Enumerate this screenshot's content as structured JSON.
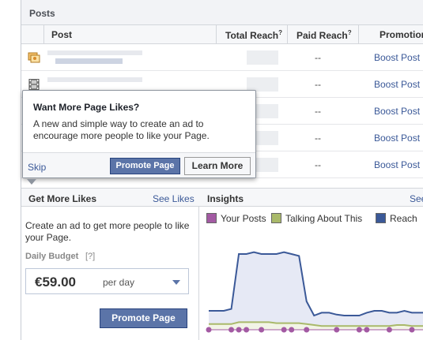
{
  "posts": {
    "title": "Posts",
    "columns": {
      "post": "Post",
      "total_reach": "Total Reach",
      "total_reach_help": "?",
      "paid_reach": "Paid Reach",
      "paid_reach_help": "?",
      "promotion": "Promotion"
    },
    "rows": [
      {
        "icon": "photo-icon",
        "paid_reach": "--",
        "action": "Boost Post"
      },
      {
        "icon": "video-icon",
        "paid_reach": "--",
        "action": "Boost Post"
      },
      {
        "icon": "post-icon",
        "paid_reach": "--",
        "action": "Boost Post"
      },
      {
        "icon": "post-icon",
        "paid_reach": "--",
        "action": "Boost Post"
      },
      {
        "icon": "post-icon",
        "paid_reach": "--",
        "action": "Boost Post"
      }
    ]
  },
  "popover": {
    "title": "Want More Page Likes?",
    "text": "A new and simple way to get create an ad to encourage more people to like your Page.",
    "skip": "Skip",
    "promote": "Promote Page",
    "learn_more": "Learn More"
  },
  "likes": {
    "title": "Get More Likes",
    "see_likes": "See Likes",
    "text": "Create an ad to get more people to like your Page.",
    "budget_label": "Daily Budget",
    "budget_help": "[?]",
    "budget_amount": "€59.00",
    "budget_unit": "per day",
    "promote": "Promote Page"
  },
  "insights": {
    "title": "Insights",
    "see_all": "See",
    "legend": [
      {
        "name": "Your Posts",
        "color": "#a35aa3"
      },
      {
        "name": "Talking About This",
        "color": "#a9b96a"
      },
      {
        "name": "Reach",
        "color": "#3b5998"
      }
    ]
  },
  "chart_data": {
    "type": "area",
    "series": [
      {
        "name": "Reach",
        "color": "#3b5998",
        "fill": "#e6e9f5",
        "values": [
          20,
          20,
          20,
          22,
          80,
          80,
          82,
          80,
          80,
          80,
          82,
          80,
          78,
          30,
          15,
          18,
          18,
          16,
          15,
          15,
          15,
          18,
          20,
          20,
          18,
          18,
          20,
          18,
          18,
          18
        ]
      },
      {
        "name": "Talking About This",
        "color": "#a9b96a",
        "values": [
          6,
          6,
          6,
          6,
          8,
          8,
          8,
          8,
          8,
          7,
          7,
          7,
          7,
          6,
          5,
          4,
          4,
          4,
          4,
          4,
          4,
          4,
          4,
          4,
          4,
          5,
          5,
          4,
          4,
          4
        ]
      },
      {
        "name": "Your Posts",
        "color": "#a35aa3",
        "points_at": [
          0,
          3,
          4,
          5,
          7,
          10,
          11,
          13,
          17,
          20,
          21,
          24,
          27,
          29
        ]
      }
    ],
    "ylim": [
      0,
      100
    ]
  }
}
